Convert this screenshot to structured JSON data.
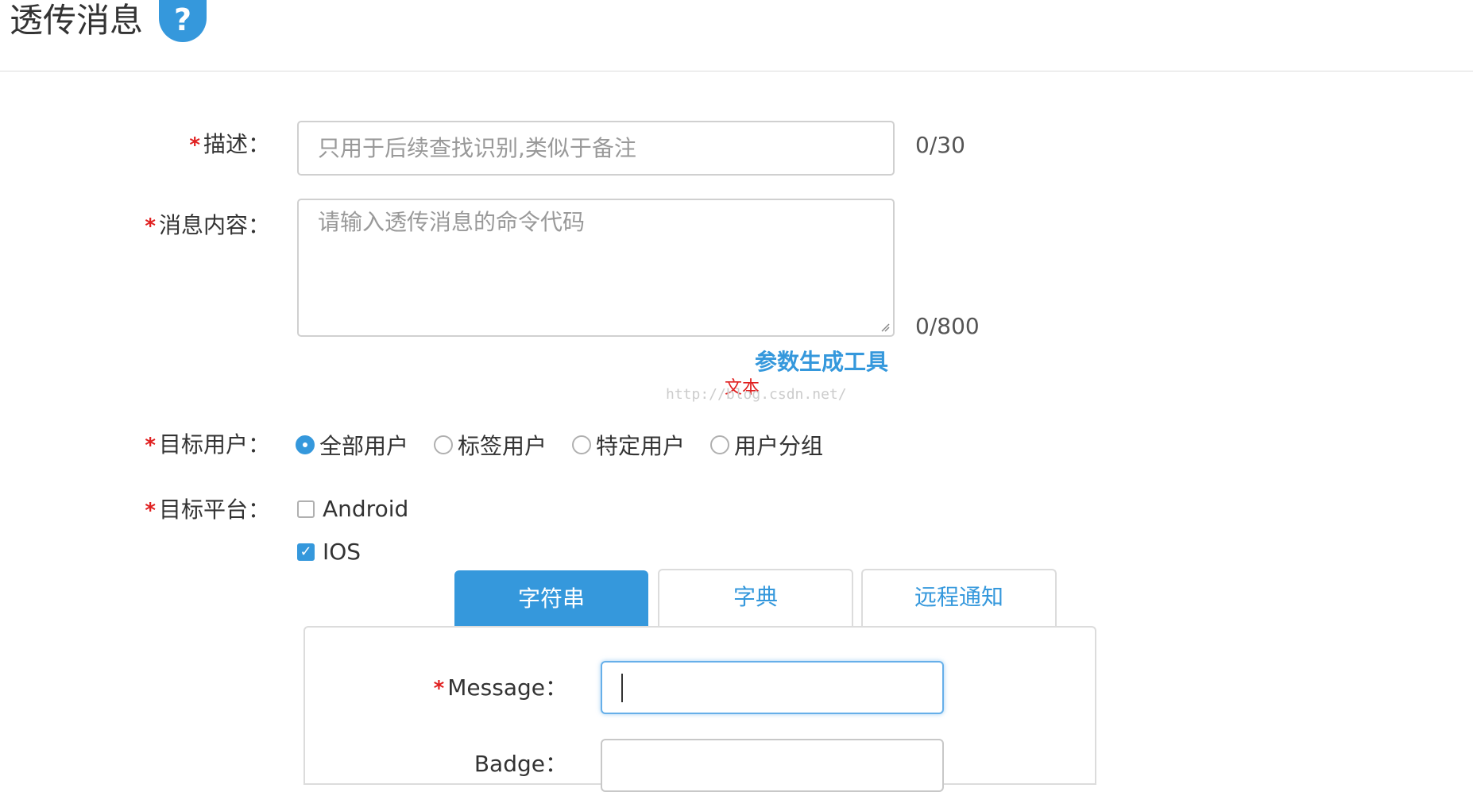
{
  "header": {
    "title": "透传消息",
    "help_icon": "question-mark-icon",
    "help_symbol": "?"
  },
  "form": {
    "required_mark": "*",
    "description": {
      "label": "描述：",
      "placeholder": "只用于后续查找识别,类似于备注",
      "counter": "0/30"
    },
    "message_content": {
      "label": "消息内容：",
      "placeholder": "请输入透传消息的命令代码",
      "counter": "0/800",
      "tool_link": "参数生成工具"
    },
    "watermark": {
      "text": "文本",
      "url": "http://blog.csdn.net/"
    },
    "target_users": {
      "label": "目标用户：",
      "options": [
        "全部用户",
        "标签用户",
        "特定用户",
        "用户分组"
      ],
      "selected": "全部用户"
    },
    "target_platform": {
      "label": "目标平台：",
      "options": [
        {
          "label": "Android",
          "checked": false
        },
        {
          "label": "IOS",
          "checked": true
        }
      ]
    },
    "ios_tabs": {
      "tabs": [
        "字符串",
        "字典",
        "远程通知"
      ],
      "active": "字符串"
    },
    "ios_fields": {
      "message_label": "Message：",
      "badge_label": "Badge："
    }
  },
  "colors": {
    "accent": "#3598dc",
    "required": "#e02020",
    "border": "#d0d0d0"
  }
}
